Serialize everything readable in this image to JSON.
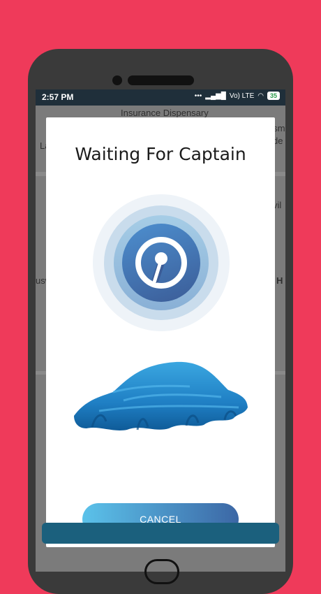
{
  "status": {
    "time": "2:57 PM",
    "network": "Vo) LTE",
    "battery": "35"
  },
  "map": {
    "labels": [
      "Insurance Dispensary",
      "asm",
      "de",
      "La",
      "vil",
      "usw",
      "H"
    ]
  },
  "dialog": {
    "title": "Waiting For Captain",
    "cancel_label": "CANCEL"
  },
  "colors": {
    "background": "#ef3a5a",
    "accent_start": "#5bc2ea",
    "accent_end": "#3c67a5"
  }
}
